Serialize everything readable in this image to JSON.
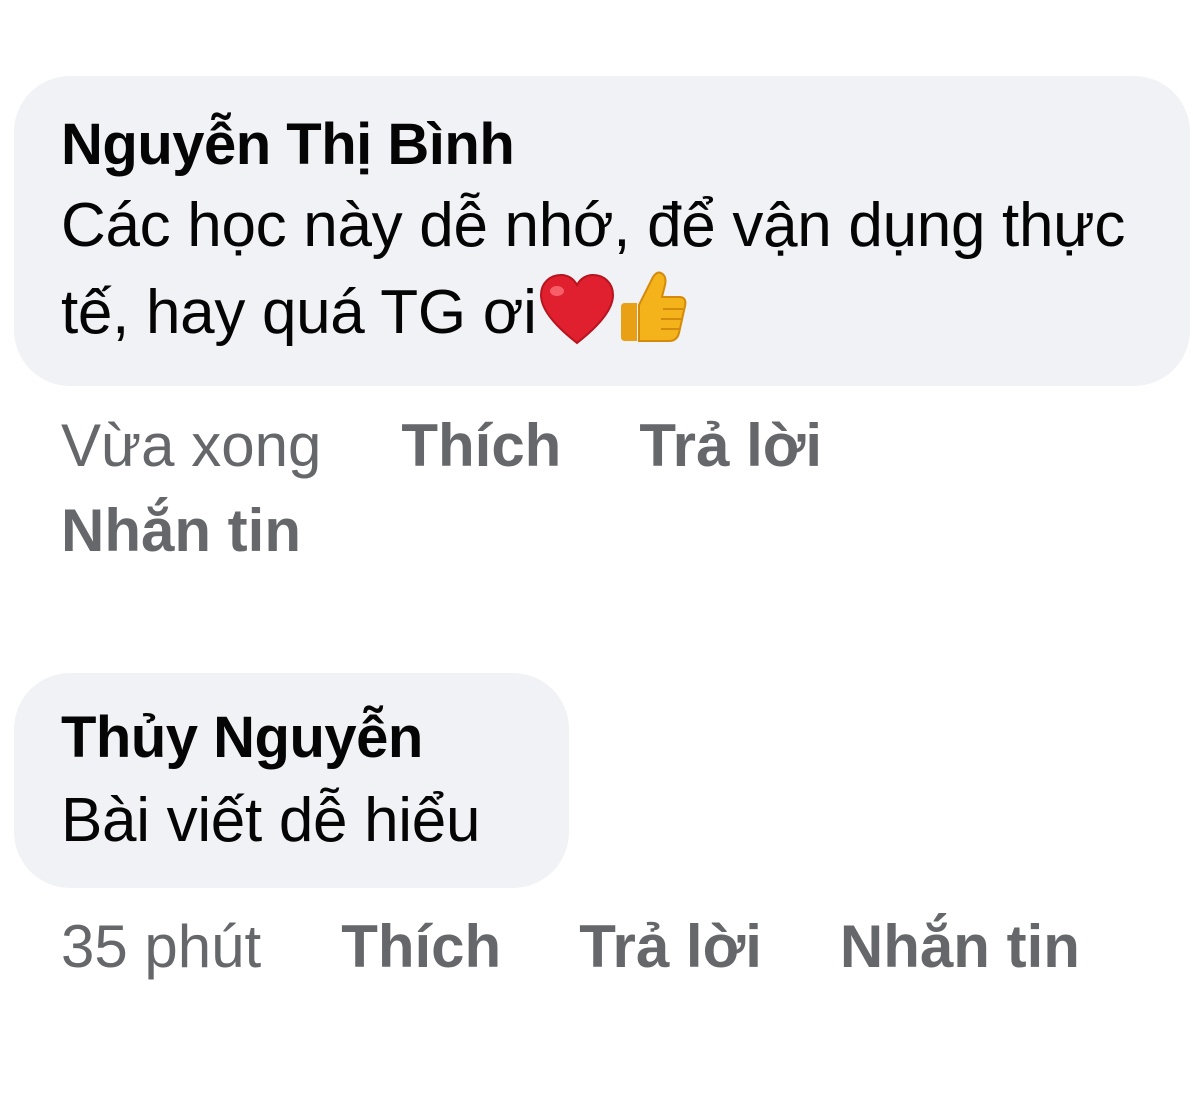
{
  "comments": [
    {
      "author": "Nguyễn Thị Bình",
      "text": "Các học này dễ nhớ,  để vận dụng thực tế,  hay quá TG ơi",
      "emojis": [
        "heart-icon",
        "thumbs-up-icon"
      ],
      "time": "Vừa xong",
      "actions": {
        "like": "Thích",
        "reply": "Trả lời",
        "message": "Nhắn tin"
      }
    },
    {
      "author": "Thủy Nguyễn",
      "text": "Bài viết dễ hiểu",
      "time": "35 phút",
      "actions": {
        "like": "Thích",
        "reply": "Trả lời",
        "message": "Nhắn tin"
      }
    }
  ],
  "colors": {
    "bubble_bg": "#f0f2f5",
    "text": "#050505",
    "meta": "#65676b",
    "heart": "#e0202e",
    "thumb": "#f5b31b"
  }
}
